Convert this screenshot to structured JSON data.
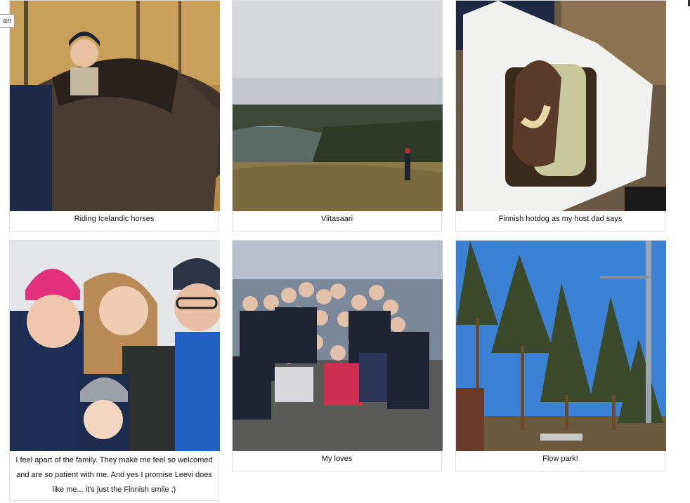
{
  "tooltip": "ari",
  "gallery": [
    {
      "caption": "Riding Icelandic horses",
      "photo": "horse-riding-photo"
    },
    {
      "caption": "Viitasaari",
      "photo": "lake-landscape-photo"
    },
    {
      "caption": "Finnish hotdog as my host dad says",
      "photo": "hotdog-photo"
    },
    {
      "caption": "I feel apart of the family. They make me feel so welcomed and are so patient with me. And yes I promise Leevi does like me... it's just the Finnish smile ;)",
      "photo": "family-selfie-photo"
    },
    {
      "caption": "My loves",
      "photo": "group-friends-photo"
    },
    {
      "caption": "Flow park!",
      "photo": "adventure-park-photo"
    }
  ],
  "colors": {
    "border": "#dddddd",
    "caption_text": "#111111"
  }
}
